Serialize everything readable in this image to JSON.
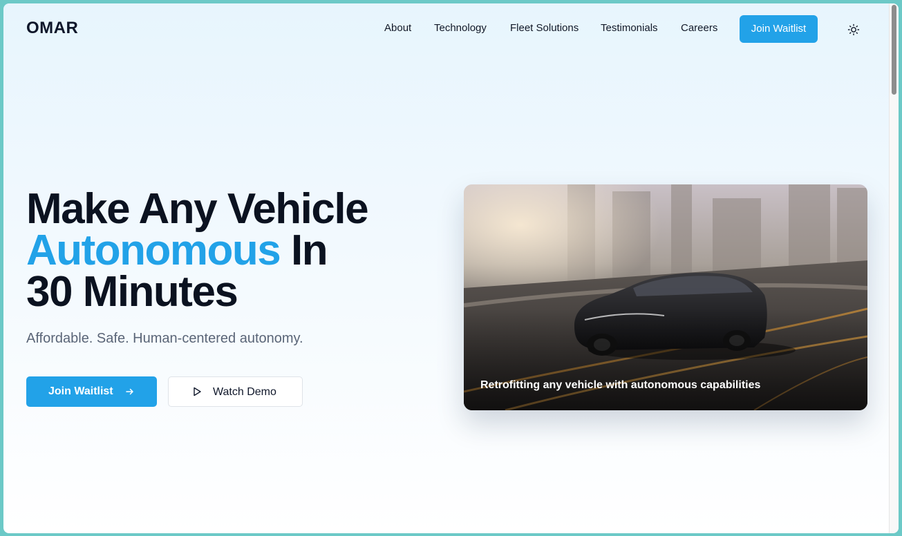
{
  "header": {
    "logo": "OMAR",
    "nav": [
      {
        "label": "About"
      },
      {
        "label": "Technology"
      },
      {
        "label": "Fleet Solutions"
      },
      {
        "label": "Testimonials"
      },
      {
        "label": "Careers"
      }
    ],
    "cta_label": "Join Waitlist",
    "theme_toggle_icon": "sun-icon"
  },
  "hero": {
    "title_line1": "Make Any Vehicle",
    "title_accent": "Autonomous",
    "title_line2_rest": "In",
    "title_line3": "30 Minutes",
    "subtitle": "Affordable. Safe. Human-centered autonomy.",
    "primary_button": {
      "label": "Join Waitlist",
      "icon": "arrow-right-icon"
    },
    "secondary_button": {
      "label": "Watch Demo",
      "icon": "play-icon"
    },
    "image_caption": "Retrofitting any vehicle with autonomous capabilities"
  },
  "colors": {
    "accent": "#22a2e8",
    "heading": "#0b1220",
    "subtitle": "#5a6577",
    "window_frame": "#6cc9c7"
  }
}
